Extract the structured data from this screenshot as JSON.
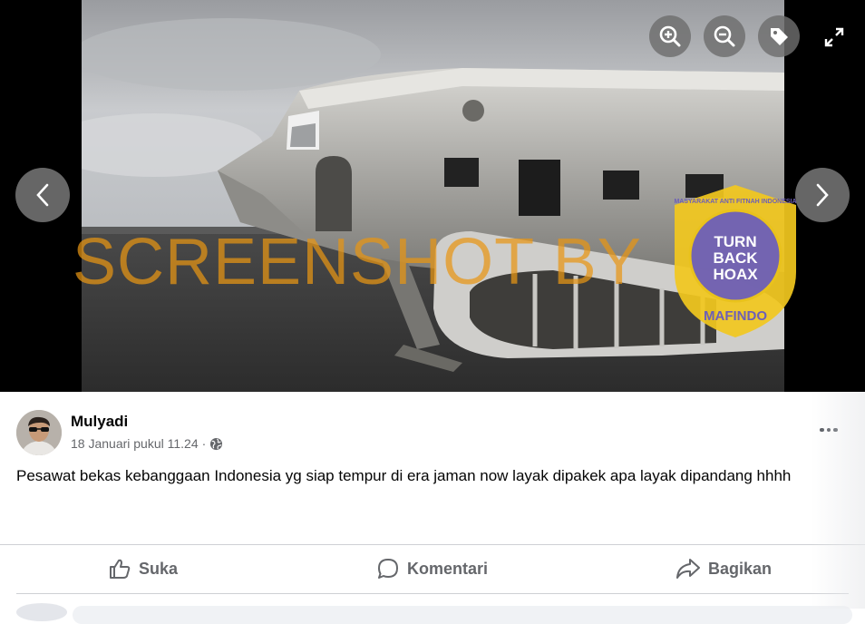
{
  "viewer": {
    "watermark_text": "SCREENSHOT BY",
    "badge": {
      "ring_text": "MASYARAKAT ANTI FITNAH INDONESIA",
      "center_lines": [
        "TURN",
        "BACK",
        "HOAX"
      ],
      "bottom_text": "MAFINDO"
    },
    "controls": {
      "zoom_in_icon": "zoom-in-icon",
      "zoom_out_icon": "zoom-out-icon",
      "tag_icon": "tag-icon",
      "fullscreen_icon": "fullscreen-icon",
      "prev_icon": "chevron-left-icon",
      "next_icon": "chevron-right-icon"
    }
  },
  "post": {
    "author": "Mulyadi",
    "timestamp": "18 Januari pukul 11.24",
    "separator": "·",
    "audience_icon": "globe-icon",
    "text": "Pesawat bekas kebanggaan Indonesia yg siap tempur di era jaman now layak dipakek apa layak dipandang hhhh",
    "actions": {
      "like": "Suka",
      "comment": "Komentari",
      "share": "Bagikan"
    }
  },
  "colors": {
    "watermark": "#e8961a",
    "secondary_text": "#65676b",
    "divider": "#ced0d4",
    "badge_bg": "#f2c81e",
    "badge_inner": "#6d5fb8"
  }
}
